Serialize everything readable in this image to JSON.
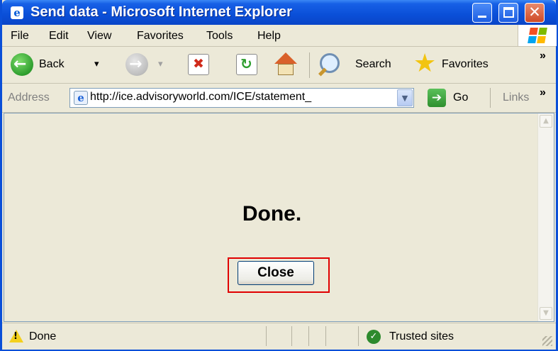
{
  "window": {
    "title": "Send data - Microsoft Internet Explorer",
    "title_icon_glyph": "e"
  },
  "menu": {
    "items": [
      "File",
      "Edit",
      "View",
      "Favorites",
      "Tools",
      "Help"
    ]
  },
  "toolbar": {
    "back_label": "Back",
    "dropdown_glyph": "▾",
    "search_label": "Search",
    "favorites_label": "Favorites",
    "overflow_glyph": "»"
  },
  "address": {
    "label": "Address",
    "url": "http://ice.advisoryworld.com/ICE/statement_",
    "go_label": "Go",
    "links_label": "Links",
    "dropdown_glyph": "▼",
    "go_glyph": "➔"
  },
  "page": {
    "heading": "Done.",
    "close_label": "Close"
  },
  "scrollbar": {
    "up_glyph": "▲",
    "down_glyph": "▼"
  },
  "status": {
    "text": "Done",
    "zone": "Trusted sites",
    "zone_glyph": "✓",
    "warning_glyph": "!"
  },
  "colors": {
    "titlebar": "#0a4fd8",
    "highlight_box": "#e00000",
    "chrome": "#ece9d8"
  },
  "icons": [
    "ie-icon",
    "minimize-icon",
    "maximize-icon",
    "close-icon",
    "windows-logo-icon",
    "back-icon",
    "forward-icon",
    "stop-icon",
    "refresh-icon",
    "home-icon",
    "search-icon",
    "favorites-star-icon",
    "go-icon",
    "warning-icon",
    "trusted-sites-icon"
  ]
}
